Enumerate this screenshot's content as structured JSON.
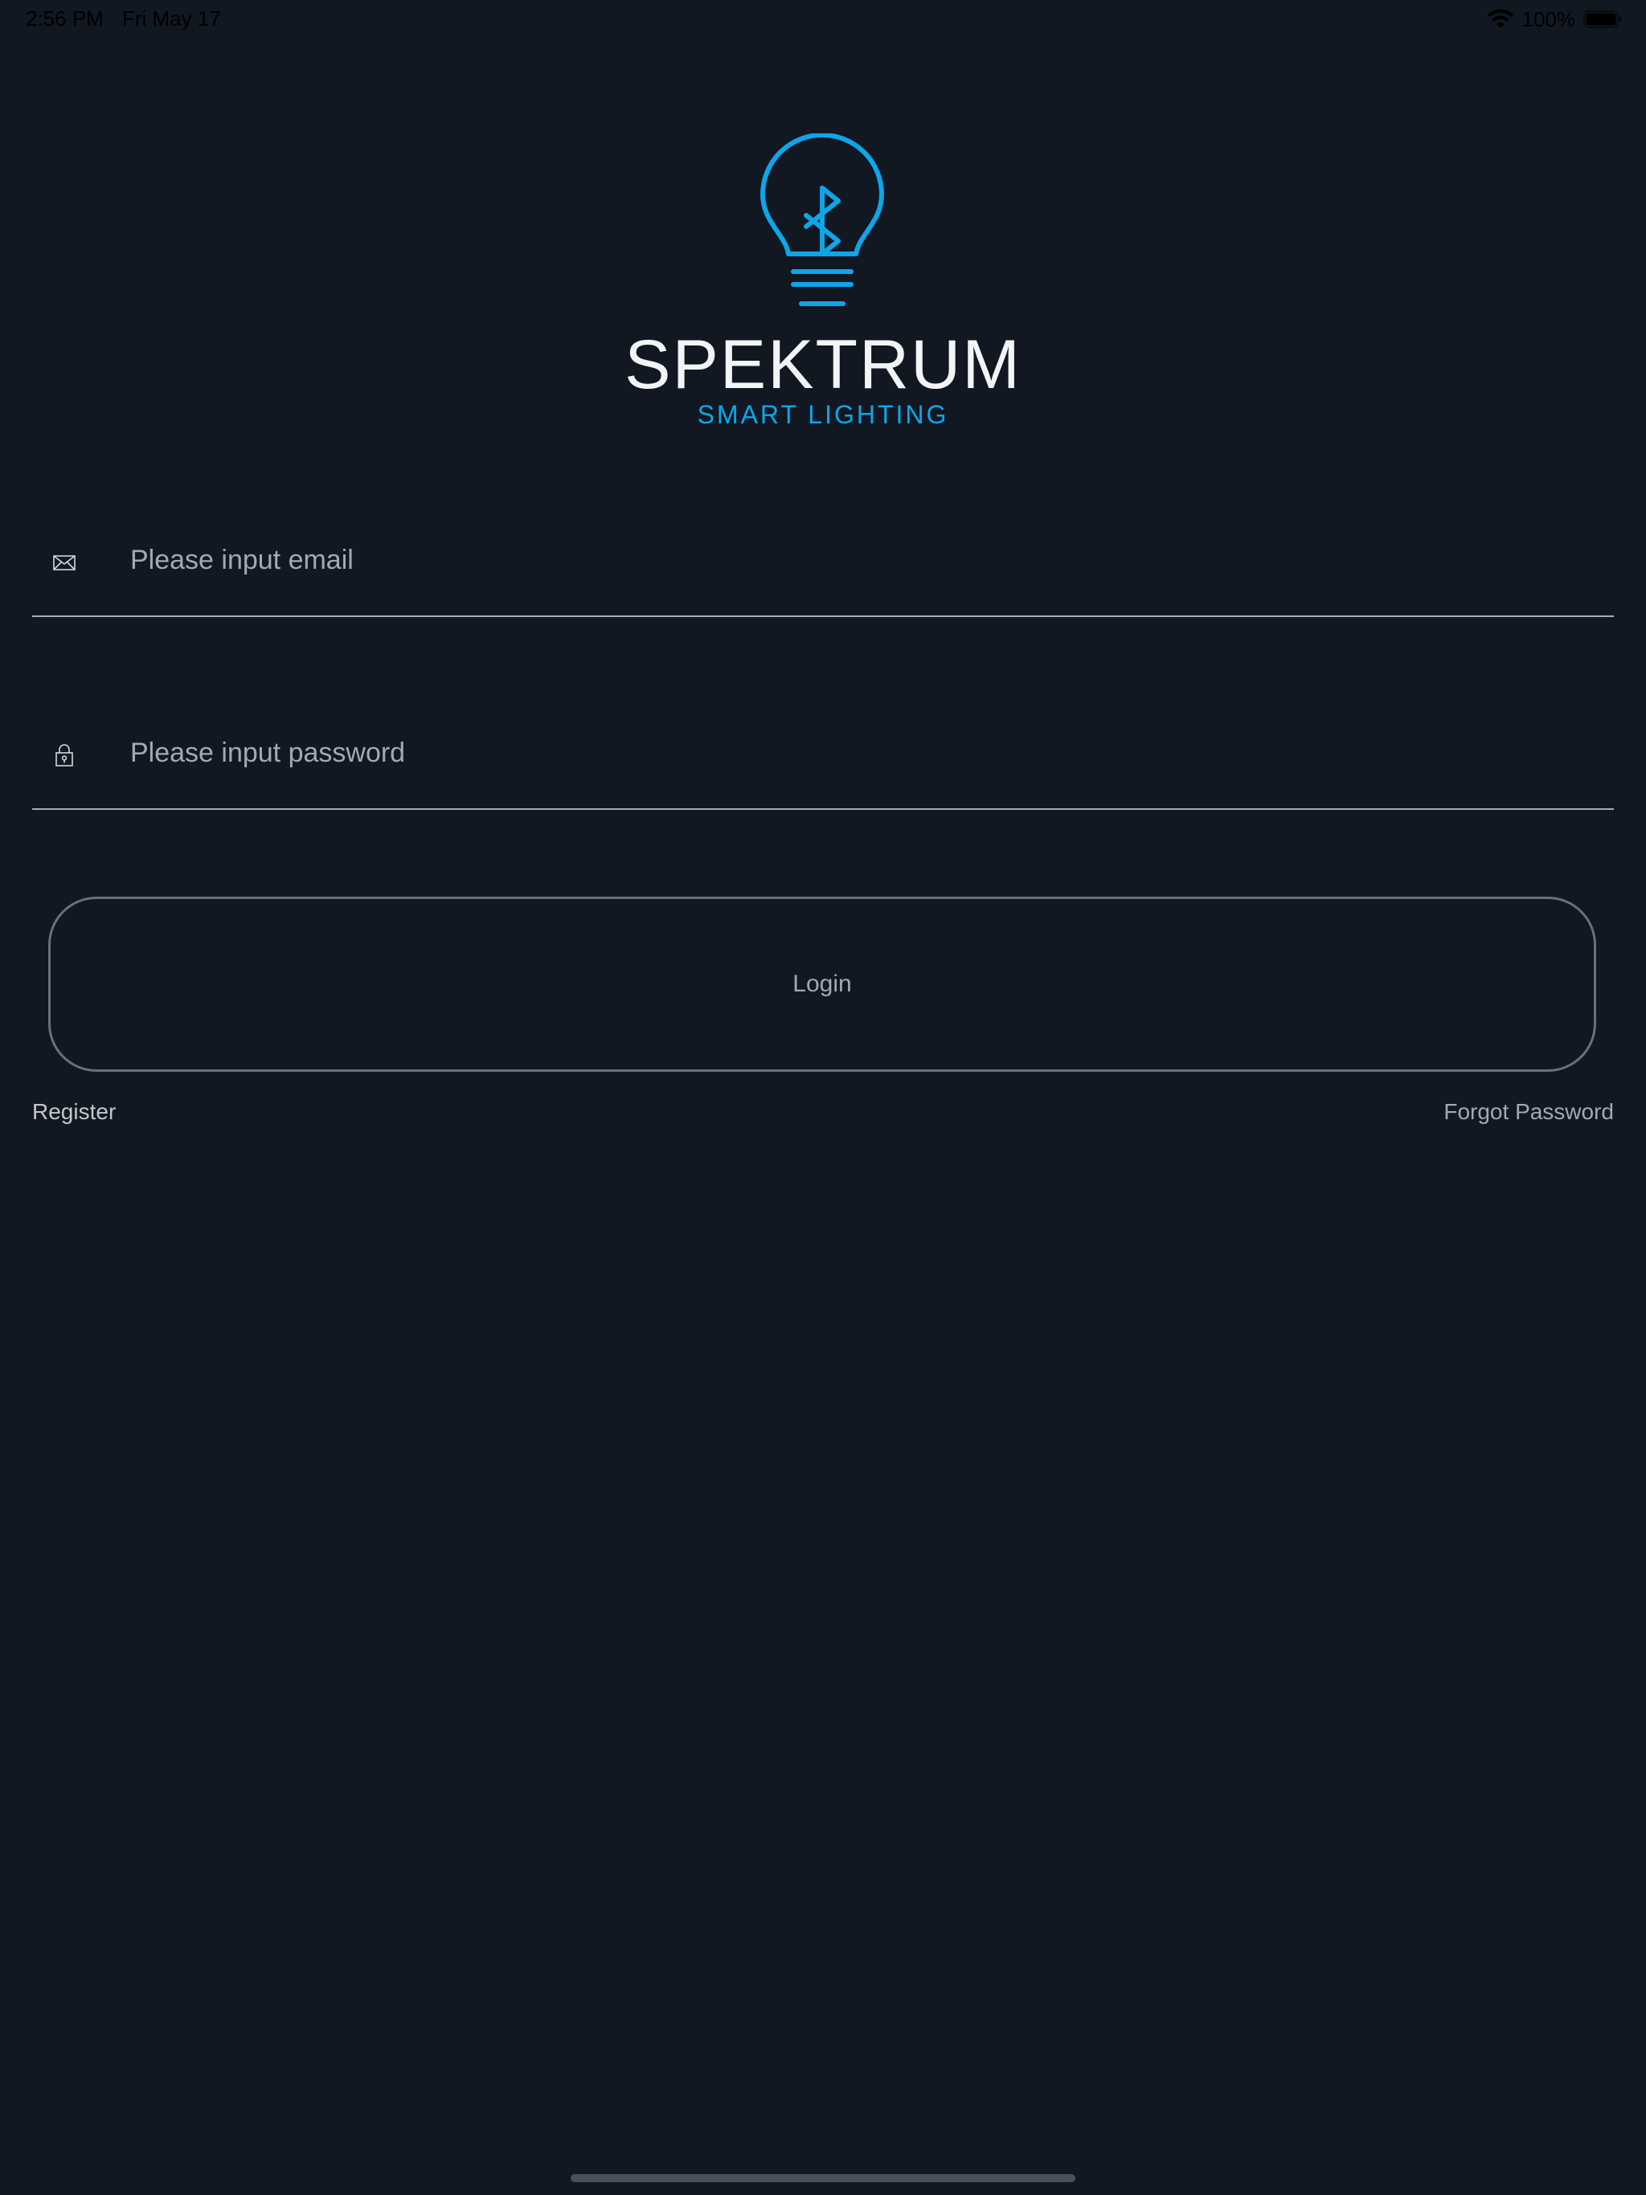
{
  "status_bar": {
    "time": "2:56 PM",
    "date": "Fri May 17",
    "battery_percent": "100%",
    "wifi_icon": "wifi-icon",
    "battery_icon": "battery-icon"
  },
  "logo": {
    "icon": "bluetooth-lightbulb-icon",
    "brand": "SPEKTRUM",
    "tagline": "SMART LIGHTING"
  },
  "login_form": {
    "email": {
      "icon": "envelope-icon",
      "placeholder": "Please input email",
      "value": ""
    },
    "password": {
      "icon": "lock-icon",
      "placeholder": "Please input password",
      "value": ""
    },
    "login_label": "Login",
    "register_label": "Register",
    "forgot_label": "Forgot Password"
  },
  "colors": {
    "background": "#111822",
    "accent": "#0ea5e9",
    "text": "#f2f4f6",
    "muted": "#a4a9af"
  }
}
